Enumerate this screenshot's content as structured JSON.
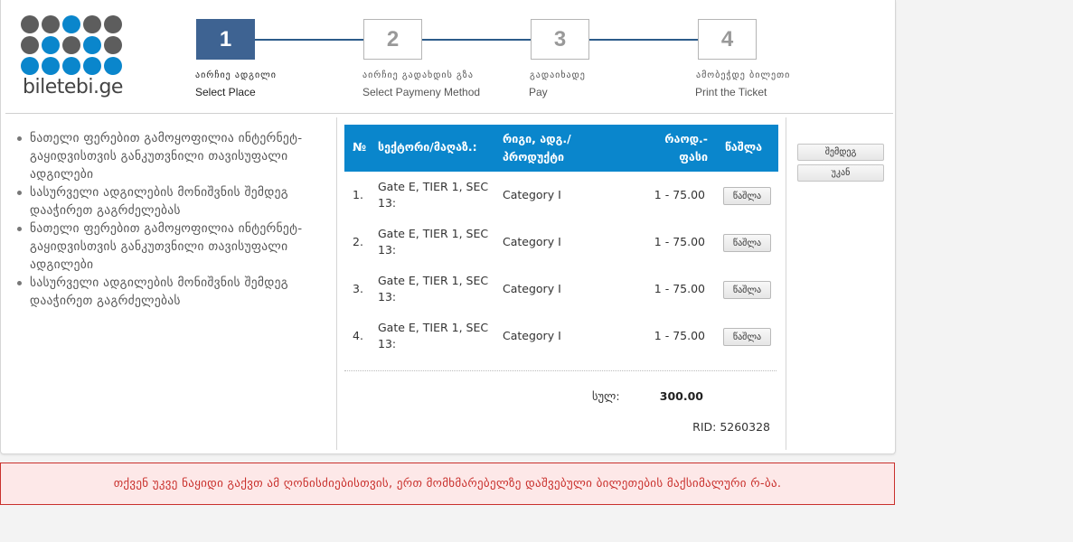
{
  "logo": {
    "text": "biletebi.ge",
    "dot_colors": [
      "#5d5d5d",
      "#5d5d5d",
      "#0a86cc",
      "#5d5d5d",
      "#5d5d5d",
      "#5d5d5d",
      "#0a86cc",
      "#5d5d5d",
      "#0a86cc",
      "#5d5d5d",
      "#0a86cc",
      "#0a86cc",
      "#0a86cc",
      "#0a86cc",
      "#0a86cc"
    ]
  },
  "steps": [
    {
      "number": "1",
      "label": "აირჩიე ადგილი",
      "sub": "Select Place",
      "active": true
    },
    {
      "number": "2",
      "label": "აირჩიე გადახდის გზა",
      "sub": "Select Paymeny Method",
      "active": false
    },
    {
      "number": "3",
      "label": "გადაიხადე",
      "sub": "Pay",
      "active": false
    },
    {
      "number": "4",
      "label": "ამობეჭდე ბილეთი",
      "sub": "Print the Ticket",
      "active": false
    }
  ],
  "instructions": [
    "ნათელი ფერებით გამოყოფილია ინტერნეტ-გაყიდვისთვის განკუთვნილი თავისუფალი ადგილები",
    "სასურველი ადგილების მონიშვნის შემდეგ დააჭირეთ გაგრძელებას",
    "ნათელი ფერებით გამოყოფილია ინტერნეტ-გაყიდვისთვის განკუთვნილი თავისუფალი ადგილები",
    "სასურველი ადგილების მონიშვნის შემდეგ დააჭირეთ გაგრძელებას"
  ],
  "table": {
    "headers": {
      "num": "№",
      "sector": "სექტორი/მაღაზ.:",
      "row_seat": "რიგი, ადგ./ პროდუქტი",
      "qty_price": "რაოდ.- ფასი",
      "delete": "წაშლა"
    },
    "rows": [
      {
        "num": "1.",
        "sector": "Gate E, TIER 1, SEC 13:",
        "category": "Category I",
        "price": "1 - 75.00",
        "delete_label": "წაშლა"
      },
      {
        "num": "2.",
        "sector": "Gate E, TIER 1, SEC 13:",
        "category": "Category I",
        "price": "1 - 75.00",
        "delete_label": "წაშლა"
      },
      {
        "num": "3.",
        "sector": "Gate E, TIER 1, SEC 13:",
        "category": "Category I",
        "price": "1 - 75.00",
        "delete_label": "წაშლა"
      },
      {
        "num": "4.",
        "sector": "Gate E, TIER 1, SEC 13:",
        "category": "Category I",
        "price": "1 - 75.00",
        "delete_label": "წაშლა"
      }
    ],
    "total_label": "სულ:",
    "total_value": "300.00",
    "rid": "RID: 5260328"
  },
  "nav": {
    "next_label": "შემდეგ",
    "back_label": "უკან"
  },
  "error_message": "თქვენ უკვე ნაყიდი გაქვთ ამ ღონისძიებისთვის, ერთ მომხმარებელზე დაშვებული ბილეთების მაქსიმალური რ-ბა.",
  "colors": {
    "accent": "#0a86cc",
    "step_active": "#3e6392",
    "error_text": "#c9302c",
    "error_bg": "#fde8e8"
  }
}
